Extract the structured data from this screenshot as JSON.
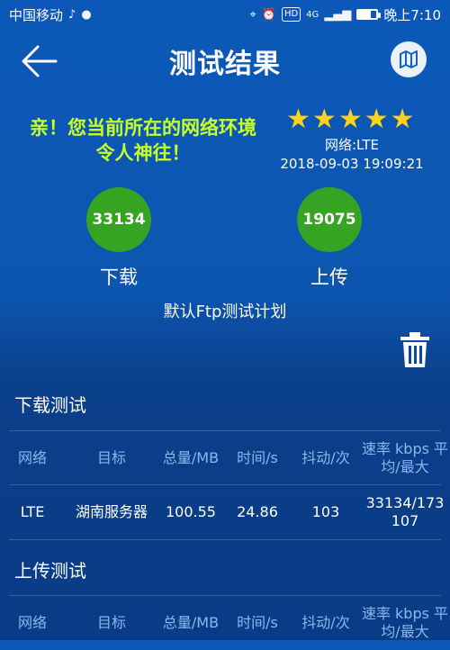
{
  "status_bar": {
    "carrier": "中国移动",
    "network_indicator": "4G",
    "time": "晚上7:10",
    "hd": "HD",
    "battery_level": 0.7
  },
  "header": {
    "title": "测试结果",
    "back_icon": "arrow-left-icon",
    "map_icon": "map-icon"
  },
  "summary": {
    "message_line1": "亲！您当前所在的网络环境",
    "message_line2": "令人神往！",
    "rating": 5,
    "network": "网络:LTE",
    "timestamp": "2018-09-03 19:09:21",
    "download_value": "33134",
    "download_label": "下载",
    "upload_value": "19075",
    "upload_label": "上传",
    "plan": "默认Ftp测试计划"
  },
  "colors": {
    "accent_green": "#37a323",
    "message_green": "#c7ff2a",
    "star": "#ffd21a",
    "header_text": "#8ab7ec"
  },
  "download_test": {
    "title": "下载测试",
    "columns": [
      "网络",
      "目标",
      "总量/MB",
      "时间/s",
      "抖动/次",
      "速率 kbps 平均/最大"
    ],
    "rows": [
      {
        "network": "LTE",
        "target": "湖南服务器",
        "total": "100.55",
        "time": "24.86",
        "jitter": "103",
        "speed": "33134/173107"
      }
    ]
  },
  "upload_test": {
    "title": "上传测试",
    "columns": [
      "网络",
      "目标",
      "总量/MB",
      "时间/s",
      "抖动/次",
      "速率 kbps 平均/最大"
    ]
  }
}
